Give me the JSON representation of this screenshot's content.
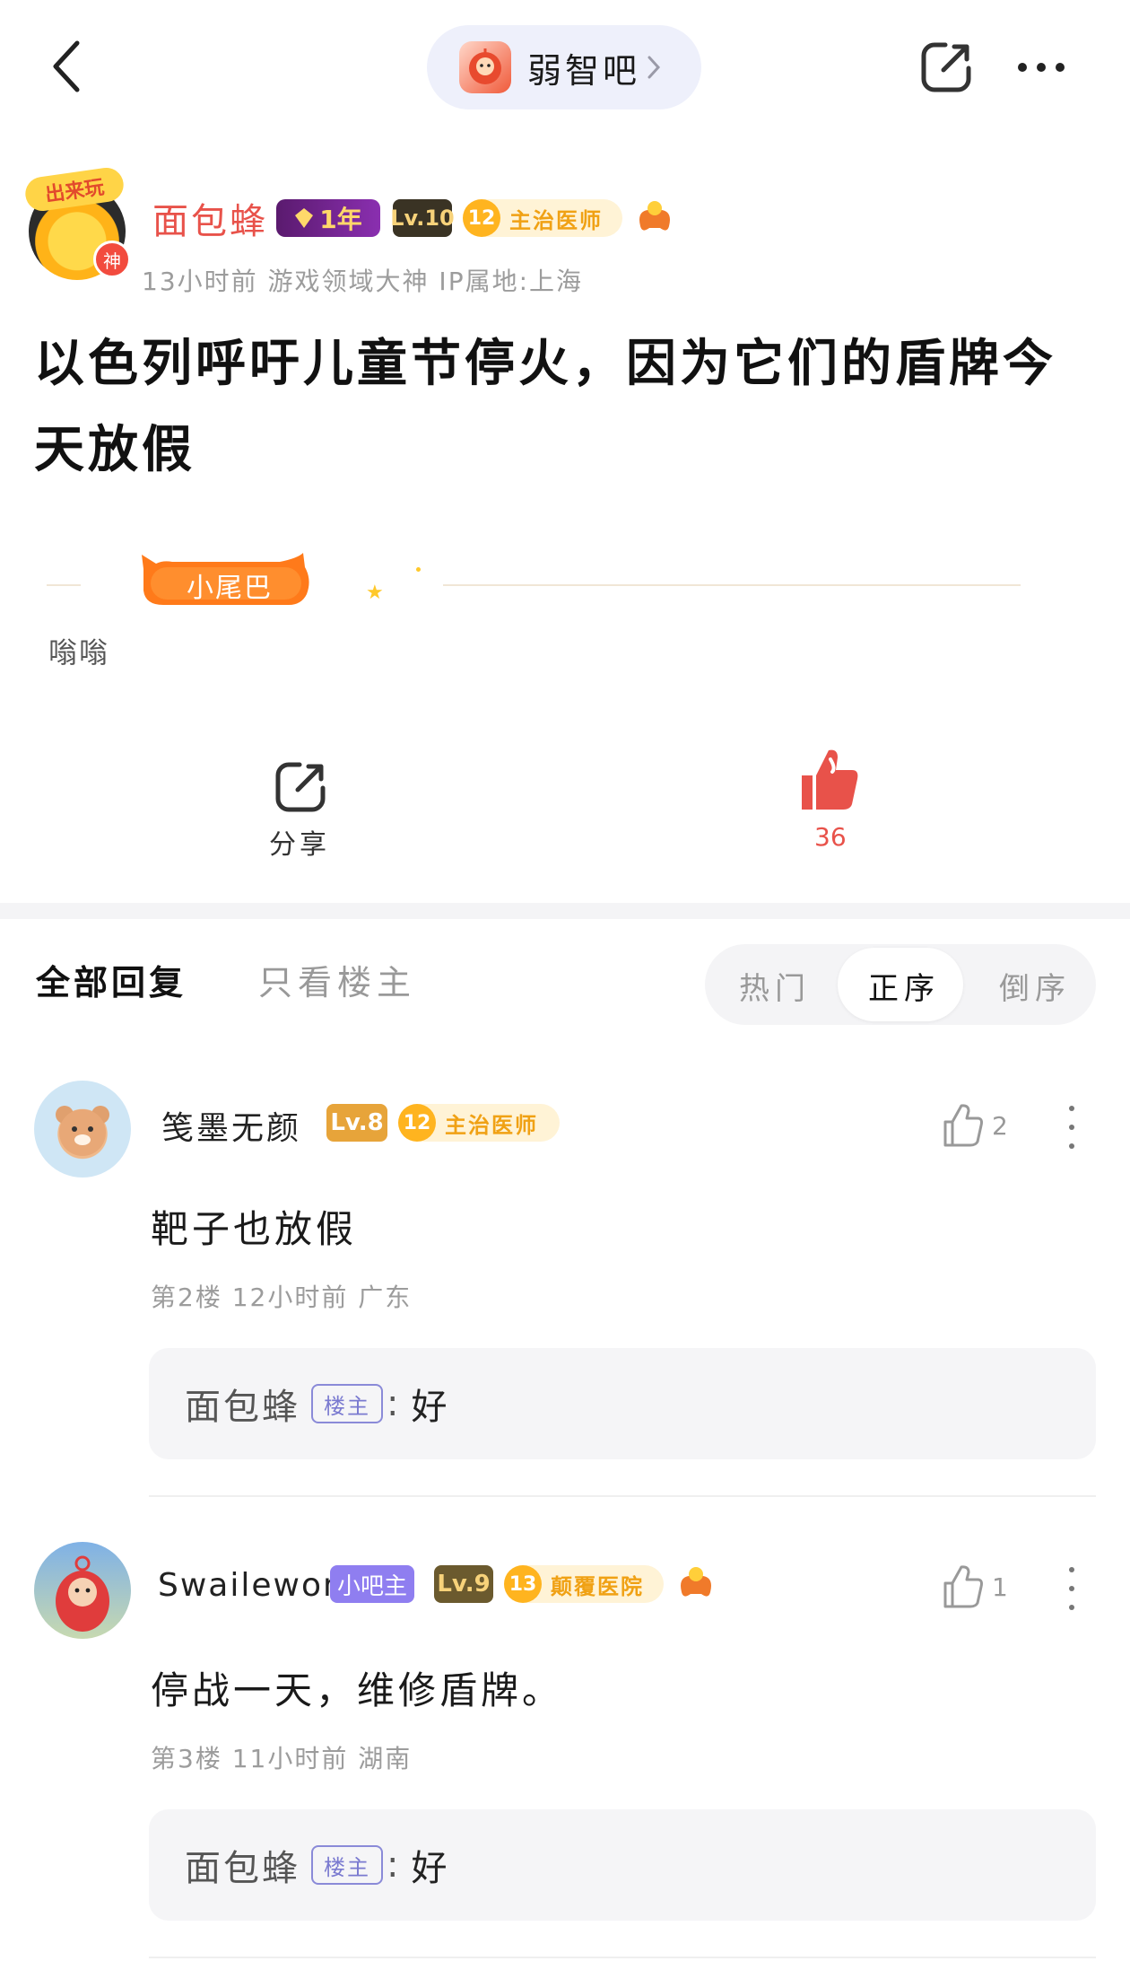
{
  "header": {
    "forum_name": "弱智吧"
  },
  "post": {
    "author": {
      "name": "面包蜂",
      "avatar_badge": "神",
      "avatar_cap": "出来玩",
      "year_badge": "1年",
      "level": "Lv.10",
      "title_level": "12",
      "title": "主治医师"
    },
    "meta": "13小时前    游戏领域大神  IP属地:上海",
    "title": "以色列呼吁儿童节停火，因为它们的盾牌今天放假",
    "tail_badge": "小尾巴",
    "tail_text": "嗡嗡",
    "share_label": "分享",
    "like_count": "36"
  },
  "tabs": {
    "all": "全部回复",
    "op_only": "只看楼主",
    "sort_hot": "热门",
    "sort_asc": "正序",
    "sort_desc": "倒序"
  },
  "comments": [
    {
      "name": "笺墨无颜",
      "level": "Lv.8",
      "title_level": "12",
      "title": "主治医师",
      "likes": "2",
      "text": "靶子也放假",
      "meta": "第2楼  12小时前  广东",
      "reply": {
        "name": "面包蜂",
        "tag": "楼主",
        "colon": ":",
        "text": "好"
      }
    },
    {
      "name": "Swailewon",
      "role": "小吧主",
      "level": "Lv.9",
      "title_level": "13",
      "title": "颠覆医院",
      "likes": "1",
      "text": "停战一天，维修盾牌。",
      "meta": "第3楼  11小时前  湖南",
      "reply": {
        "name": "面包蜂",
        "tag": "楼主",
        "colon": ":",
        "text": "好"
      }
    }
  ],
  "colors": {
    "accent_red": "#e8524a",
    "op_tag": "#7a7ad0",
    "level_gold": "#f0a114",
    "role_purple": "#8f7ef0"
  }
}
